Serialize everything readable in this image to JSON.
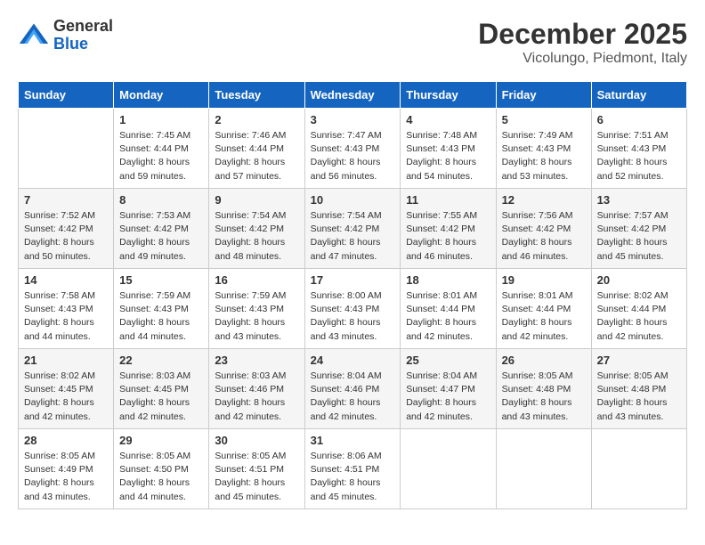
{
  "header": {
    "logo_general": "General",
    "logo_blue": "Blue",
    "month_title": "December 2025",
    "location": "Vicolungo, Piedmont, Italy"
  },
  "days_of_week": [
    "Sunday",
    "Monday",
    "Tuesday",
    "Wednesday",
    "Thursday",
    "Friday",
    "Saturday"
  ],
  "weeks": [
    [
      {
        "day": "",
        "info": ""
      },
      {
        "day": "1",
        "info": "Sunrise: 7:45 AM\nSunset: 4:44 PM\nDaylight: 8 hours\nand 59 minutes."
      },
      {
        "day": "2",
        "info": "Sunrise: 7:46 AM\nSunset: 4:44 PM\nDaylight: 8 hours\nand 57 minutes."
      },
      {
        "day": "3",
        "info": "Sunrise: 7:47 AM\nSunset: 4:43 PM\nDaylight: 8 hours\nand 56 minutes."
      },
      {
        "day": "4",
        "info": "Sunrise: 7:48 AM\nSunset: 4:43 PM\nDaylight: 8 hours\nand 54 minutes."
      },
      {
        "day": "5",
        "info": "Sunrise: 7:49 AM\nSunset: 4:43 PM\nDaylight: 8 hours\nand 53 minutes."
      },
      {
        "day": "6",
        "info": "Sunrise: 7:51 AM\nSunset: 4:43 PM\nDaylight: 8 hours\nand 52 minutes."
      }
    ],
    [
      {
        "day": "7",
        "info": "Sunrise: 7:52 AM\nSunset: 4:42 PM\nDaylight: 8 hours\nand 50 minutes."
      },
      {
        "day": "8",
        "info": "Sunrise: 7:53 AM\nSunset: 4:42 PM\nDaylight: 8 hours\nand 49 minutes."
      },
      {
        "day": "9",
        "info": "Sunrise: 7:54 AM\nSunset: 4:42 PM\nDaylight: 8 hours\nand 48 minutes."
      },
      {
        "day": "10",
        "info": "Sunrise: 7:54 AM\nSunset: 4:42 PM\nDaylight: 8 hours\nand 47 minutes."
      },
      {
        "day": "11",
        "info": "Sunrise: 7:55 AM\nSunset: 4:42 PM\nDaylight: 8 hours\nand 46 minutes."
      },
      {
        "day": "12",
        "info": "Sunrise: 7:56 AM\nSunset: 4:42 PM\nDaylight: 8 hours\nand 46 minutes."
      },
      {
        "day": "13",
        "info": "Sunrise: 7:57 AM\nSunset: 4:42 PM\nDaylight: 8 hours\nand 45 minutes."
      }
    ],
    [
      {
        "day": "14",
        "info": "Sunrise: 7:58 AM\nSunset: 4:43 PM\nDaylight: 8 hours\nand 44 minutes."
      },
      {
        "day": "15",
        "info": "Sunrise: 7:59 AM\nSunset: 4:43 PM\nDaylight: 8 hours\nand 44 minutes."
      },
      {
        "day": "16",
        "info": "Sunrise: 7:59 AM\nSunset: 4:43 PM\nDaylight: 8 hours\nand 43 minutes."
      },
      {
        "day": "17",
        "info": "Sunrise: 8:00 AM\nSunset: 4:43 PM\nDaylight: 8 hours\nand 43 minutes."
      },
      {
        "day": "18",
        "info": "Sunrise: 8:01 AM\nSunset: 4:44 PM\nDaylight: 8 hours\nand 42 minutes."
      },
      {
        "day": "19",
        "info": "Sunrise: 8:01 AM\nSunset: 4:44 PM\nDaylight: 8 hours\nand 42 minutes."
      },
      {
        "day": "20",
        "info": "Sunrise: 8:02 AM\nSunset: 4:44 PM\nDaylight: 8 hours\nand 42 minutes."
      }
    ],
    [
      {
        "day": "21",
        "info": "Sunrise: 8:02 AM\nSunset: 4:45 PM\nDaylight: 8 hours\nand 42 minutes."
      },
      {
        "day": "22",
        "info": "Sunrise: 8:03 AM\nSunset: 4:45 PM\nDaylight: 8 hours\nand 42 minutes."
      },
      {
        "day": "23",
        "info": "Sunrise: 8:03 AM\nSunset: 4:46 PM\nDaylight: 8 hours\nand 42 minutes."
      },
      {
        "day": "24",
        "info": "Sunrise: 8:04 AM\nSunset: 4:46 PM\nDaylight: 8 hours\nand 42 minutes."
      },
      {
        "day": "25",
        "info": "Sunrise: 8:04 AM\nSunset: 4:47 PM\nDaylight: 8 hours\nand 42 minutes."
      },
      {
        "day": "26",
        "info": "Sunrise: 8:05 AM\nSunset: 4:48 PM\nDaylight: 8 hours\nand 43 minutes."
      },
      {
        "day": "27",
        "info": "Sunrise: 8:05 AM\nSunset: 4:48 PM\nDaylight: 8 hours\nand 43 minutes."
      }
    ],
    [
      {
        "day": "28",
        "info": "Sunrise: 8:05 AM\nSunset: 4:49 PM\nDaylight: 8 hours\nand 43 minutes."
      },
      {
        "day": "29",
        "info": "Sunrise: 8:05 AM\nSunset: 4:50 PM\nDaylight: 8 hours\nand 44 minutes."
      },
      {
        "day": "30",
        "info": "Sunrise: 8:05 AM\nSunset: 4:51 PM\nDaylight: 8 hours\nand 45 minutes."
      },
      {
        "day": "31",
        "info": "Sunrise: 8:06 AM\nSunset: 4:51 PM\nDaylight: 8 hours\nand 45 minutes."
      },
      {
        "day": "",
        "info": ""
      },
      {
        "day": "",
        "info": ""
      },
      {
        "day": "",
        "info": ""
      }
    ]
  ]
}
